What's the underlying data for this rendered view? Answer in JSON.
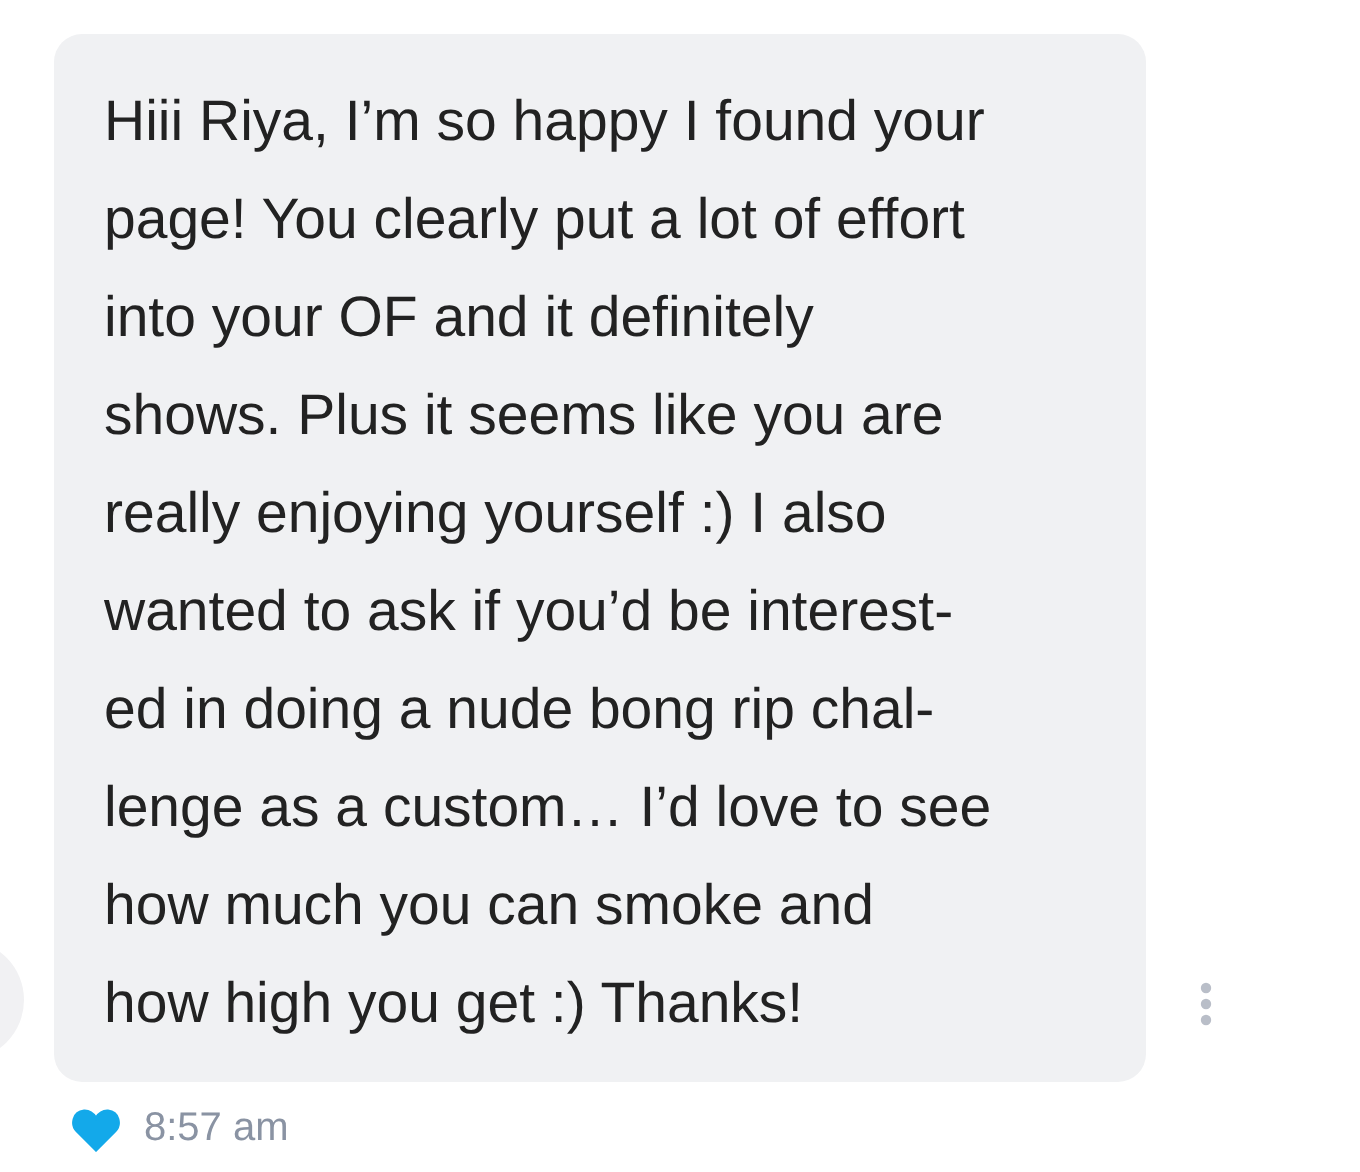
{
  "message": {
    "lines": [
      "Hiii Riya, I’m so happy I found your",
      "page! You clearly put a lot of effort",
      "into your OF and it definitely",
      "shows. Plus it seems like you are",
      "really enjoying yourself :) I also",
      "wanted to ask if you’d be interest-",
      "ed in doing a nude bong rip chal-",
      "lenge as a custom… I’d love to see",
      "how much you can smoke and",
      "how high you get :) Thanks!"
    ],
    "liked": true,
    "time": "8:57 am"
  }
}
